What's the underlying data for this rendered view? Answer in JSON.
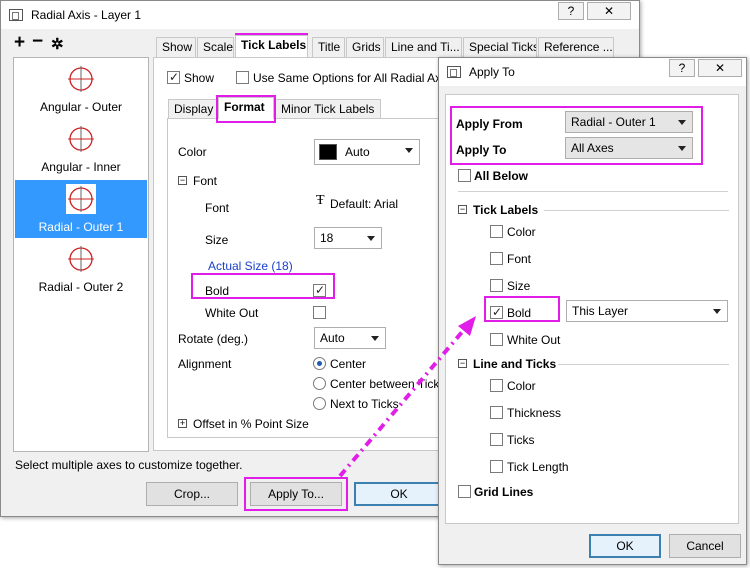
{
  "main_window": {
    "title": "Radial Axis - Layer 1",
    "help_glyph": "?",
    "close_glyph": "✕",
    "toolbar_add": "+",
    "toolbar_remove": "−",
    "toolbar_settings": "✲",
    "axis_list": [
      {
        "label": "Angular - Outer",
        "selected": false
      },
      {
        "label": "Angular - Inner",
        "selected": false
      },
      {
        "label": "Radial - Outer 1",
        "selected": true
      },
      {
        "label": "Radial - Outer 2",
        "selected": false
      }
    ],
    "tabs": [
      "Show",
      "Scale",
      "Tick Labels",
      "Title",
      "Grids",
      "Line and Ti...",
      "Special Ticks",
      "Reference ..."
    ],
    "active_tab": "Tick Labels",
    "show_label": "Show",
    "show_checked": true,
    "same_options_label": "Use Same Options for All Radial Axe",
    "same_options_checked": false,
    "subtabs": [
      "Display",
      "Format",
      "Minor Tick Labels"
    ],
    "active_subtab": "Format",
    "color_label": "Color",
    "color_value": "Auto",
    "color_swatch": "#000000",
    "font_group_label": "Font",
    "font_label": "Font",
    "font_value": "Default: Arial",
    "font_type_glyph": "Ŧ",
    "size_label": "Size",
    "size_value": "18",
    "actual_size_link": "Actual Size (18)",
    "bold_label": "Bold",
    "bold_checked": true,
    "whiteout_label": "White Out",
    "whiteout_checked": false,
    "rotate_label": "Rotate (deg.)",
    "rotate_value": "Auto",
    "alignment_label": "Alignment",
    "alignment_options": [
      {
        "label": "Center",
        "selected": true
      },
      {
        "label": "Center between Ticks",
        "selected": false
      },
      {
        "label": "Next to Ticks",
        "selected": false
      }
    ],
    "offset_label": "Offset in % Point Size",
    "status_text": "Select multiple axes to customize together.",
    "crop_button": "Crop...",
    "apply_to_button": "Apply To...",
    "ok_button": "OK"
  },
  "apply_dialog": {
    "title": "Apply To",
    "help_glyph": "?",
    "close_glyph": "✕",
    "apply_from_label": "Apply From",
    "apply_from_value": "Radial - Outer 1",
    "apply_to_label": "Apply To",
    "apply_to_value": "All Axes",
    "all_below_label": "All Below",
    "tick_labels_group": "Tick Labels",
    "tick_items": [
      {
        "label": "Color",
        "checked": false
      },
      {
        "label": "Font",
        "checked": false
      },
      {
        "label": "Size",
        "checked": false
      },
      {
        "label": "Bold",
        "checked": true
      },
      {
        "label": "White Out",
        "checked": false
      }
    ],
    "bold_scope_value": "This Layer",
    "line_ticks_group": "Line and Ticks",
    "line_items": [
      {
        "label": "Color",
        "checked": false
      },
      {
        "label": "Thickness",
        "checked": false
      },
      {
        "label": "Ticks",
        "checked": false
      },
      {
        "label": "Tick Length",
        "checked": false
      }
    ],
    "grid_lines_label": "Grid Lines",
    "ok_button": "OK",
    "cancel_button": "Cancel"
  },
  "colors": {
    "highlight": "#e11ee8",
    "selection": "#3399ff",
    "link": "#1b3fcc",
    "axis_thumb_red": "#cc2020"
  }
}
